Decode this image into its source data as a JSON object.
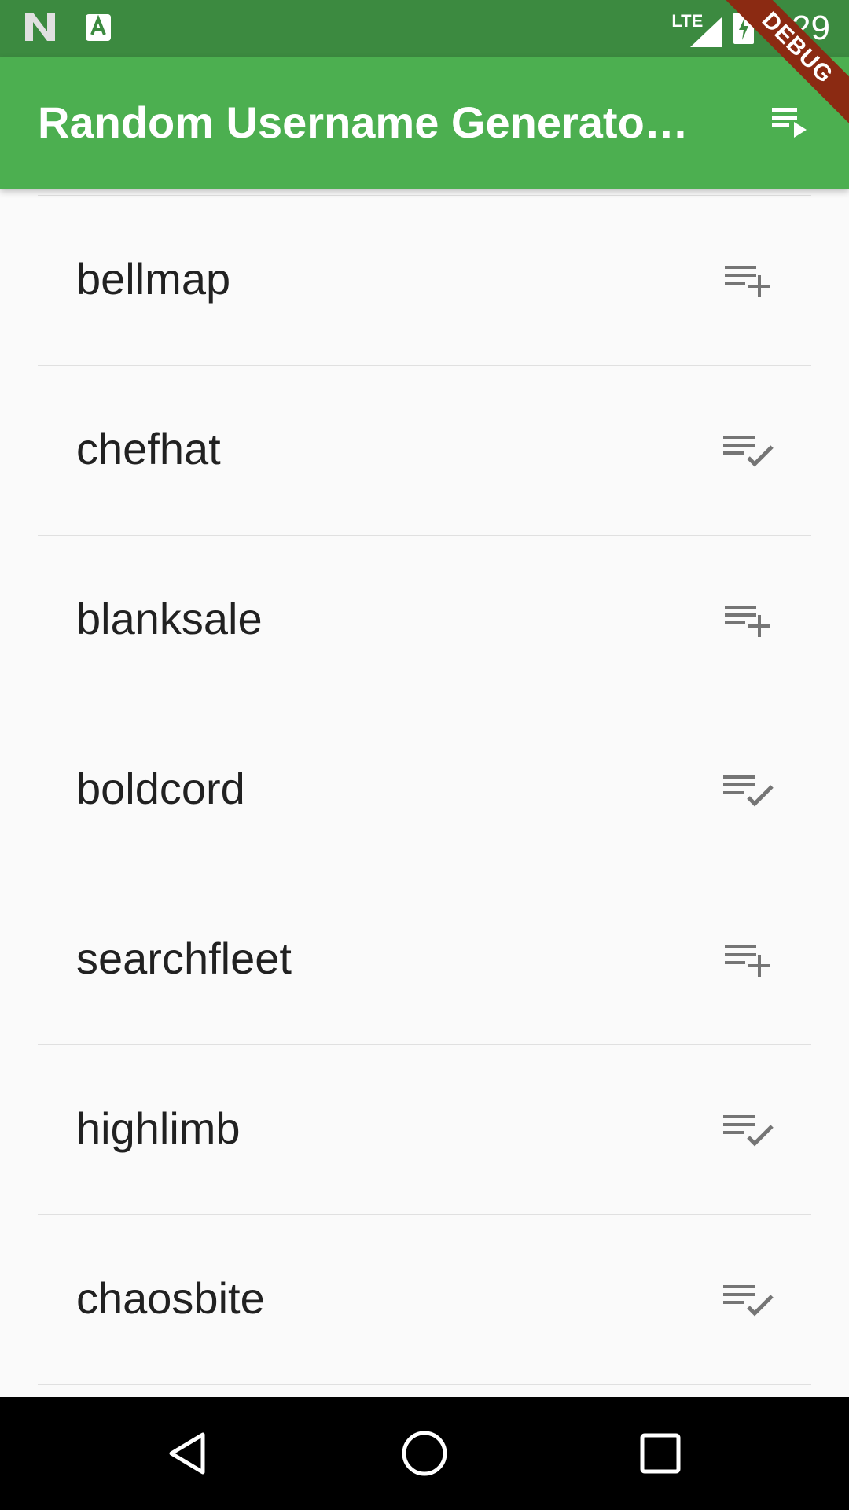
{
  "status_bar": {
    "time": "7:29",
    "network": "LTE",
    "icons": [
      "n-logo-icon",
      "android-a-icon",
      "signal-icon",
      "battery-charging-icon"
    ]
  },
  "debug_banner": "DEBUG",
  "app_bar": {
    "title": "Random Username Generator…",
    "action_icon": "playlist-play-icon",
    "color": "#4caf50"
  },
  "list": {
    "items": [
      {
        "label": "bellmap",
        "icon": "playlist-add-icon"
      },
      {
        "label": "chefhat",
        "icon": "playlist-add-check-icon"
      },
      {
        "label": "blanksale",
        "icon": "playlist-add-icon"
      },
      {
        "label": "boldcord",
        "icon": "playlist-add-check-icon"
      },
      {
        "label": "searchfleet",
        "icon": "playlist-add-icon"
      },
      {
        "label": "highlimb",
        "icon": "playlist-add-check-icon"
      },
      {
        "label": "chaosbite",
        "icon": "playlist-add-check-icon"
      }
    ]
  },
  "nav_bar": {
    "buttons": [
      "back-icon",
      "home-icon",
      "recents-icon"
    ]
  }
}
